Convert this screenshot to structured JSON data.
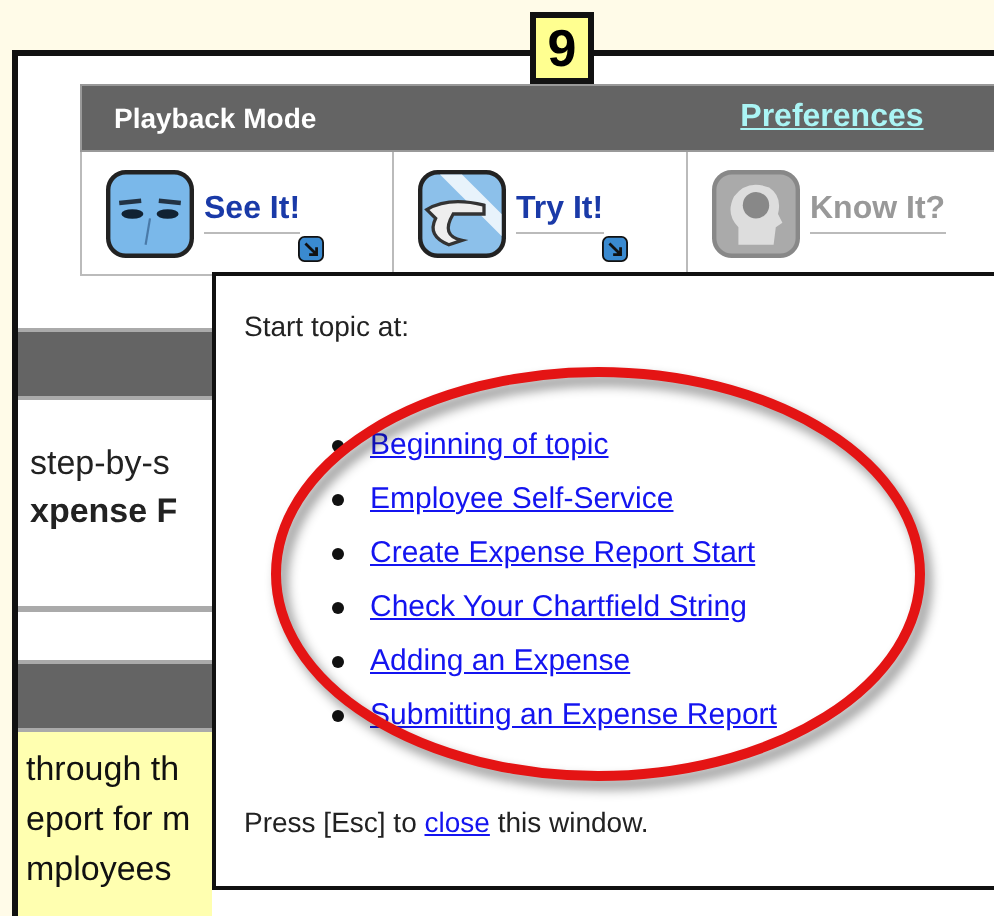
{
  "badge": "9",
  "toolbar": {
    "title": "Playback Mode",
    "link": "Preferences"
  },
  "modes": [
    {
      "label": "See It!",
      "kind": "see",
      "disabled": false
    },
    {
      "label": "Try It!",
      "kind": "try",
      "disabled": false
    },
    {
      "label": "Know It?",
      "kind": "know",
      "disabled": true
    }
  ],
  "page_behind": {
    "upper_lines": [
      {
        "text": "step-by-s",
        "bold": false
      },
      {
        "text": "xpense F",
        "bold": true
      }
    ],
    "lower_lines": [
      "through th",
      "eport for m",
      "mployees"
    ]
  },
  "popup": {
    "heading": "Start topic at:",
    "links": [
      "Beginning of topic",
      "Employee Self-Service",
      "Create Expense Report Start",
      "Check Your Chartfield String",
      "Adding an Expense",
      "Submitting an Expense Report"
    ],
    "footer": {
      "before": "Press [Esc] to ",
      "link": "close",
      "after": " this window."
    }
  }
}
